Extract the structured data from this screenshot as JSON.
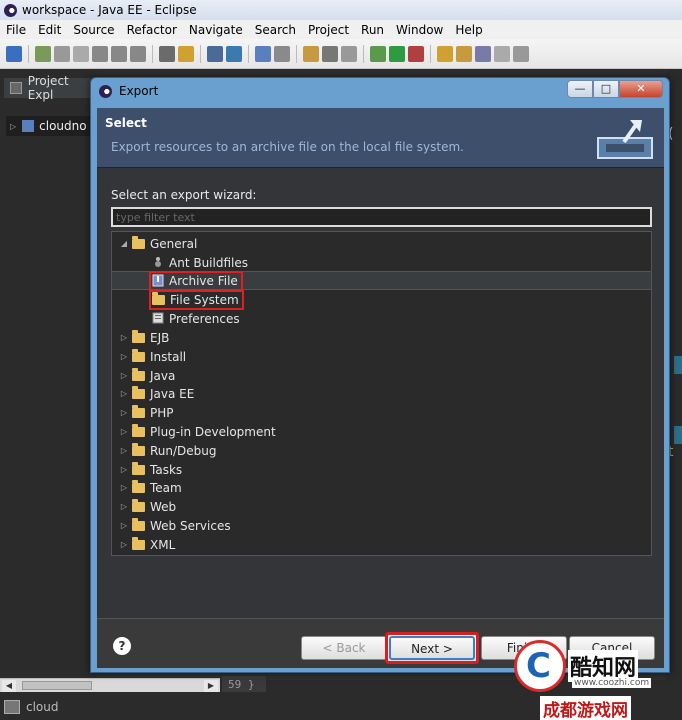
{
  "window": {
    "title": "workspace - Java EE - Eclipse"
  },
  "menu": [
    "File",
    "Edit",
    "Source",
    "Refactor",
    "Navigate",
    "Search",
    "Project",
    "Run",
    "Window",
    "Help"
  ],
  "left_view": {
    "tab_label": "Project Expl",
    "project": "cloudno"
  },
  "editor": {
    "line_number": "59 }",
    "glyph_top": "(",
    "glyph_bottom": "t"
  },
  "status": {
    "text": "cloud"
  },
  "dialog": {
    "title": "Export",
    "controls": {
      "minimize": "—",
      "maximize": "□",
      "close": "✕"
    },
    "banner": {
      "title": "Select",
      "description": "Export resources to an archive file on the local file system."
    },
    "wizard_label": "Select an export wizard:",
    "filter_placeholder": "type filter text",
    "tree": [
      {
        "label": "General",
        "expanded": true,
        "level": 0
      },
      {
        "label": "Ant Buildfiles",
        "level": 1,
        "icon": "ant-icon"
      },
      {
        "label": "Archive File",
        "level": 1,
        "icon": "archive-icon",
        "selected": true,
        "highlighted": true
      },
      {
        "label": "File System",
        "level": 1,
        "icon": "folder-icon",
        "highlighted": true
      },
      {
        "label": "Preferences",
        "level": 1,
        "icon": "preferences-icon"
      },
      {
        "label": "EJB",
        "level": 0
      },
      {
        "label": "Install",
        "level": 0
      },
      {
        "label": "Java",
        "level": 0
      },
      {
        "label": "Java EE",
        "level": 0
      },
      {
        "label": "PHP",
        "level": 0
      },
      {
        "label": "Plug-in Development",
        "level": 0
      },
      {
        "label": "Run/Debug",
        "level": 0
      },
      {
        "label": "Tasks",
        "level": 0
      },
      {
        "label": "Team",
        "level": 0
      },
      {
        "label": "Web",
        "level": 0
      },
      {
        "label": "Web Services",
        "level": 0
      },
      {
        "label": "XML",
        "level": 0
      }
    ],
    "buttons": {
      "help": "?",
      "back": "< Back",
      "next": "Next >",
      "finish": "Finish",
      "cancel": "Cancel"
    }
  },
  "watermark": {
    "brand": "酷知网",
    "url": "www.coozhi.com",
    "sub": "成都游戏网"
  },
  "colors": {
    "highlight": "#e02020",
    "next_frame": "#d81e1e",
    "banner_bg": "#3d4f6b"
  }
}
